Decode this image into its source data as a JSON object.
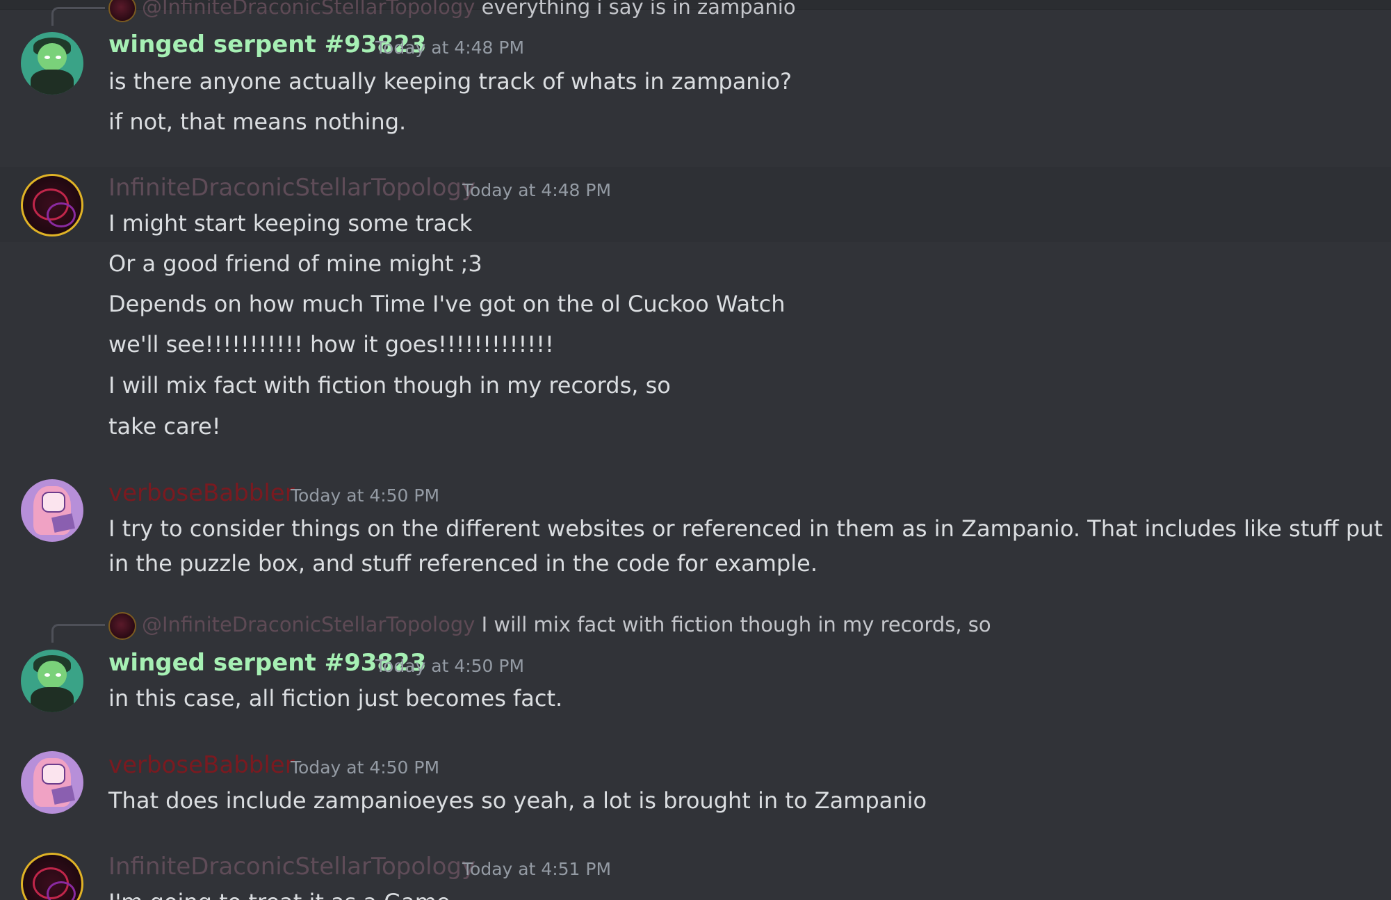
{
  "messages": [
    {
      "reply": {
        "mention": "@InfiniteDraconicStellarTopology",
        "text": "everything i say is in zampanio"
      },
      "author": "winged serpent #93823",
      "time": "Today at 4:48 PM",
      "lines": [
        "is there anyone actually keeping track of whats in zampanio?",
        "if not, that means nothing."
      ]
    },
    {
      "author": "InfiniteDraconicStellarTopology",
      "time": "Today at 4:48 PM",
      "lines": [
        "I might start keeping some track",
        "Or a good friend of mine might ;3",
        "Depends on how much Time I've got on the ol Cuckoo Watch",
        "we'll see!!!!!!!!!!! how it goes!!!!!!!!!!!!!",
        "I will mix fact with fiction though in my records, so",
        "take care!"
      ]
    },
    {
      "author": "verboseBabbler",
      "time": "Today at 4:50 PM",
      "lines": [
        "I try to consider things on the different websites or referenced in them as in Zampanio. That includes like stuff put in the puzzle box, and stuff referenced in the code for example."
      ]
    },
    {
      "reply": {
        "mention": "@InfiniteDraconicStellarTopology",
        "text": "I will mix fact with fiction though in my records, so"
      },
      "author": "winged serpent #93823",
      "time": "Today at 4:50 PM",
      "lines": [
        "in this case, all fiction just becomes fact."
      ]
    },
    {
      "author": "verboseBabbler",
      "time": "Today at 4:50 PM",
      "lines": [
        "That does include zampanioeyes so yeah, a lot is brought in to Zampanio"
      ]
    },
    {
      "author": "InfiniteDraconicStellarTopology",
      "time": "Today at 4:51 PM",
      "lines": [
        "I'm going to treat it as a Game"
      ]
    }
  ]
}
